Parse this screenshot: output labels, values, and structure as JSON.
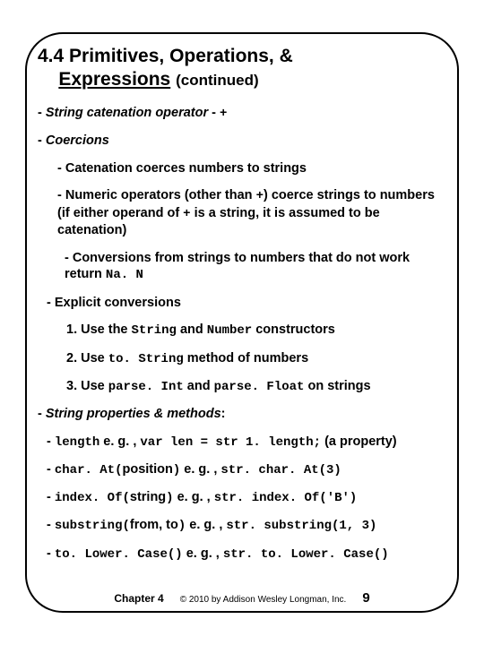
{
  "title_line1": "4.4 Primitives, Operations, &",
  "title_line2": "Expressions",
  "title_cont": "(continued)",
  "sec1_head": "String catenation operator",
  "sec1_op": "+",
  "sec2_head": "Coercions",
  "sec2_sub1": "- Catenation coerces numbers to strings",
  "sec2_sub2a": "- Numeric operators (other than ",
  "sec2_sub2_op1": "+",
  "sec2_sub2b": ") coerce strings to numbers (if either operand of ",
  "sec2_sub2_op2": "+",
  "sec2_sub2c": " is a string, it is assumed to be catenation)",
  "sec2_sub3a": "- Conversions from strings to numbers that do not work return ",
  "sec2_sub3_nan": "Na. N",
  "sec3_head": "- Explicit conversions",
  "sec3_l1a": "1. Use the ",
  "sec3_l1_string": "String",
  "sec3_l1b": " and ",
  "sec3_l1_number": "Number",
  "sec3_l1c": " constructors",
  "sec3_l2a": "2. Use ",
  "sec3_l2_tostr": "to. String",
  "sec3_l2b": " method of numbers",
  "sec3_l3a": "3. Use ",
  "sec3_l3_pi": "parse. Int",
  "sec3_l3b": " and ",
  "sec3_l3_pf": "parse. Float",
  "sec3_l3c": " on strings",
  "sec4_head": "String properties & methods",
  "m1a": "length",
  "m1b": "  e. g. , ",
  "m1c": "var len = str 1. length;",
  "m1d": " (a property)",
  "m2a": "char. At(",
  "m2b": "position",
  "m2c": ")",
  "m2d": "  e. g. , ",
  "m2e": "str. char. At(3)",
  "m3a": "index. Of(",
  "m3b": "string",
  "m3c": ")",
  "m3d": "  e. g. , ",
  "m3e": "str. index. Of('B')",
  "m4a": "substring(",
  "m4b": "from, to",
  "m4c": ")",
  "m4d": "  e. g. , ",
  "m4e": "str. substring(1, 3)",
  "m5a": "to. Lower. Case()",
  "m5b": "  e. g. , ",
  "m5c": "str. to. Lower. Case()",
  "footer_chapter": "Chapter 4",
  "footer_copy": "© 2010 by Addison Wesley Longman, Inc.",
  "footer_page": "9"
}
